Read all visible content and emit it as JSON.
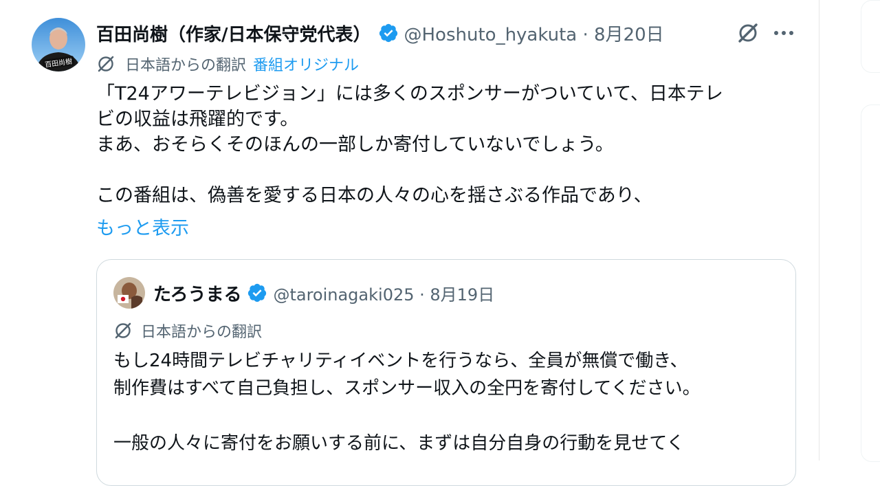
{
  "author": {
    "display_name": "百田尚樹（作家/日本保守党代表）",
    "handle_meta": "@Hoshuto_hyakuta · 8月20日"
  },
  "translation": {
    "label": "日本語からの翻訳",
    "link": "番組オリジナル"
  },
  "body": {
    "lines": [
      "「T24アワーテレビジョン」には多くのスポンサーがついていて、日本テレ",
      "ビの収益は飛躍的です。",
      "まあ、おそらくそのほんの一部しか寄付していないでしょう。",
      "",
      "この番組は、偽善を愛する日本の人々の心を揺さぶる作品であり、"
    ],
    "show_more": "もっと表示"
  },
  "quoted": {
    "display_name": "たろうまる",
    "handle_meta": "@taroinagaki025 · 8月19日",
    "translation_label": "日本語からの翻訳",
    "lines": [
      "もし24時間テレビチャリティイベントを行うなら、全員が無償で働き、",
      "制作費はすべて自己負担し、スポンサー収入の全円を寄付してください。",
      "",
      "一般の人々に寄付をお願いする前に、まずは自分自身の行動を見せてく"
    ]
  },
  "avatar_badge_text": "百田尚樹",
  "icons": {
    "verified": "verified-badge-icon",
    "grok": "grok-icon",
    "more": "more-dots-icon",
    "translate": "translate-icon"
  },
  "colors": {
    "accent": "#1d9bf0",
    "secondary_text": "#536471",
    "primary_text": "#0f1419",
    "border": "#cfd9de"
  }
}
